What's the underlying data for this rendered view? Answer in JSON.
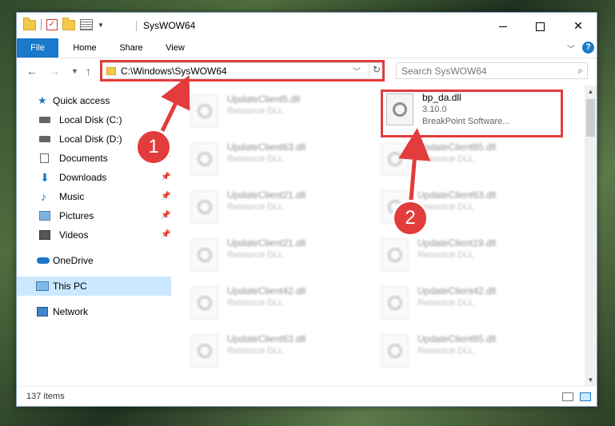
{
  "window": {
    "title": "SysWOW64",
    "controls": {
      "minimize": "",
      "maximize": "",
      "close": "✕"
    }
  },
  "ribbon": {
    "tabs": [
      {
        "label": "File"
      },
      {
        "label": "Home"
      },
      {
        "label": "Share"
      },
      {
        "label": "View"
      }
    ],
    "help": "?"
  },
  "address": {
    "path": "C:\\Windows\\SysWOW64",
    "search_placeholder": "Search SysWOW64"
  },
  "sidebar": {
    "items": [
      {
        "label": "Quick access",
        "icon": "star-icon"
      },
      {
        "label": "Local Disk (C:)",
        "icon": "disk-icon"
      },
      {
        "label": "Local Disk (D:)",
        "icon": "disk-icon"
      },
      {
        "label": "Documents",
        "icon": "documents-icon",
        "pinned": true
      },
      {
        "label": "Downloads",
        "icon": "download-icon",
        "pinned": true
      },
      {
        "label": "Music",
        "icon": "music-icon",
        "pinned": true
      },
      {
        "label": "Pictures",
        "icon": "pictures-icon",
        "pinned": true
      },
      {
        "label": "Videos",
        "icon": "videos-icon",
        "pinned": true
      },
      {
        "label": "OneDrive",
        "icon": "cloud-icon"
      },
      {
        "label": "This PC",
        "icon": "computer-icon",
        "selected": true
      },
      {
        "label": "Network",
        "icon": "network-icon"
      }
    ]
  },
  "files": {
    "highlighted": {
      "name": "bp_da.dll",
      "version": "3.10.0",
      "company": "BreakPoint Software..."
    },
    "blurred_left": [
      {
        "name": "UpdateClient5.dll",
        "type": "Resource DLL"
      },
      {
        "name": "UpdateClient63.dll",
        "type": "Resource DLL"
      },
      {
        "name": "UpdateClient21.dll",
        "type": "Resource DLL"
      },
      {
        "name": "UpdateClient21.dll",
        "type": "Resource DLL"
      },
      {
        "name": "UpdateClient42.dll",
        "type": "Resource DLL"
      },
      {
        "name": "UpdateClient63.dll",
        "type": "Resource DLL"
      }
    ],
    "blurred_right": [
      {
        "name": "UpdateClient65.dll",
        "type": "Resource DLL"
      },
      {
        "name": "UpdateClient63.dll",
        "type": "Resource DLL"
      },
      {
        "name": "UpdateClient19.dll",
        "type": "Resource DLL"
      },
      {
        "name": "UpdateClient42.dll",
        "type": "Resource DLL"
      },
      {
        "name": "UpdateClient65.dll",
        "type": "Resource DLL"
      }
    ]
  },
  "status": {
    "item_count": "137 items"
  },
  "annotations": {
    "badge1": "1",
    "badge2": "2",
    "color": "#e23c3c"
  }
}
